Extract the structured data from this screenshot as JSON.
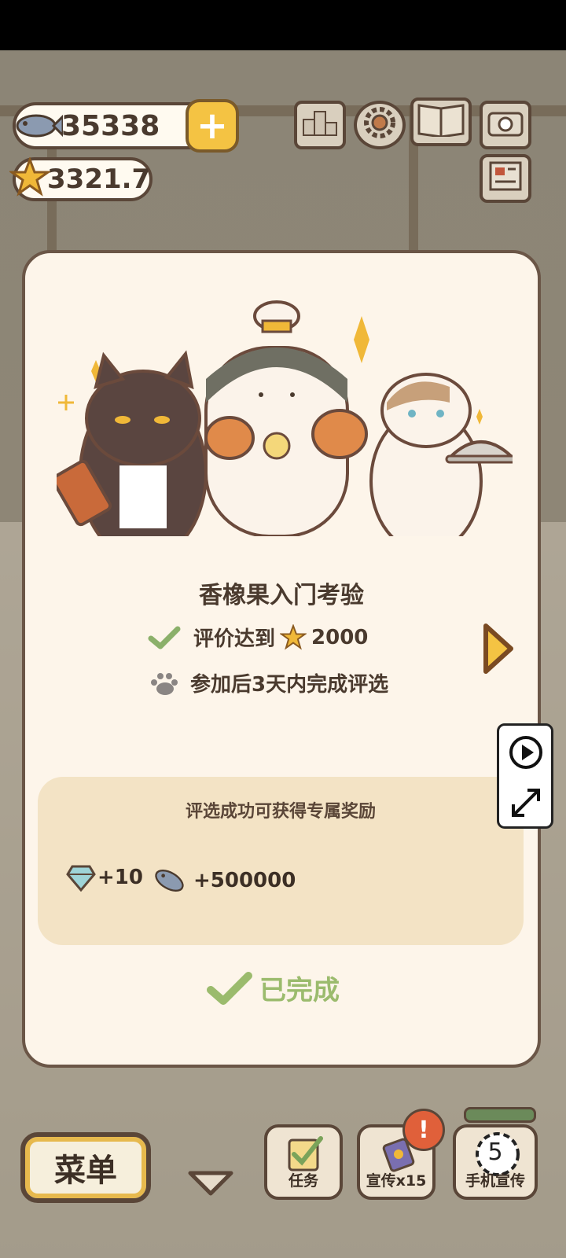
{
  "hud": {
    "fish_count": "35338",
    "star_rating": "3321.7",
    "icons": [
      "fish-icon",
      "star-icon",
      "plus-icon",
      "ranking-icon",
      "settings-gear-icon",
      "catalog-book-icon",
      "camera-icon",
      "newspaper-icon"
    ]
  },
  "modal": {
    "title": "香橡果入门考验",
    "conditions": [
      {
        "icon": "check-icon",
        "text_before": "评价达到",
        "icon_inline": "star-icon",
        "value": "2000",
        "completed": true
      },
      {
        "icon": "paw-icon",
        "text": "参加后3天内完成评选",
        "completed": false
      }
    ],
    "reward_section": {
      "title": "评选成功可获得专属奖励",
      "rewards": [
        {
          "icon": "diamond-icon",
          "amount": "+10"
        },
        {
          "icon": "fish-icon",
          "amount": "+500000"
        }
      ]
    },
    "status": "已完成"
  },
  "bottom_bar": {
    "menu_label": "菜单",
    "tasks_label": "任务",
    "promo_label": "宣传x15",
    "phone_label": "手机宣传",
    "badge_text": "!",
    "phone_timer": "5"
  },
  "colors": {
    "modal_bg": "#fdf5ea",
    "reward_bg": "#f3e3c5",
    "done_green": "#9bbb6d",
    "accent_yellow": "#f4c343",
    "border_brown": "#5a4638"
  }
}
